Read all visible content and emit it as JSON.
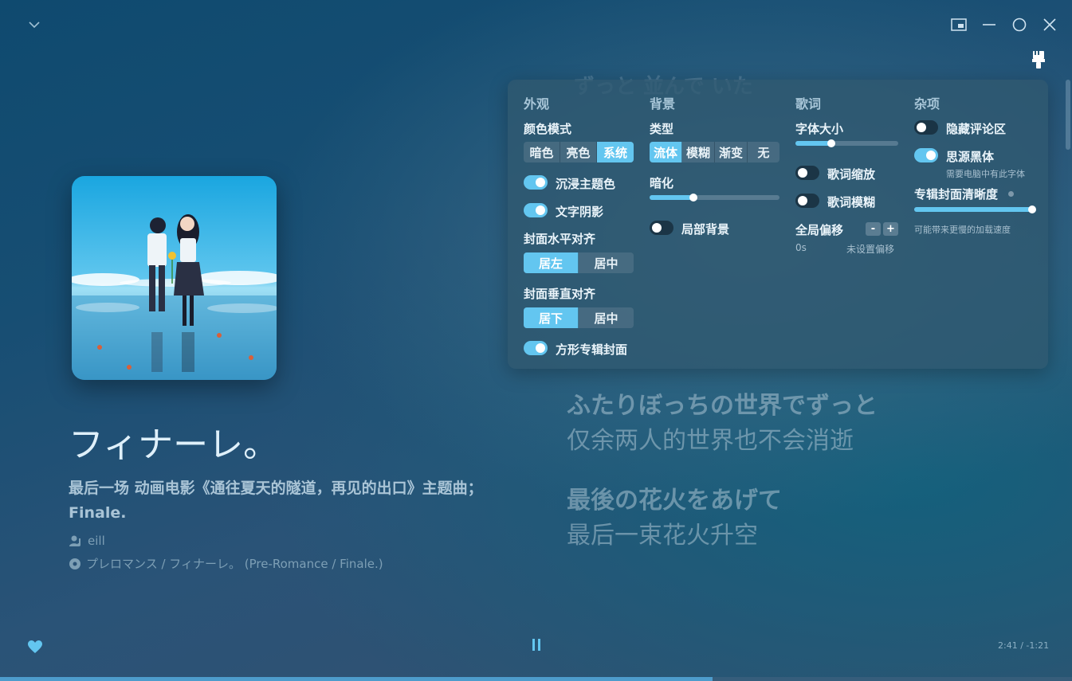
{
  "window": {
    "collapse_icon": "chevron-down-icon",
    "controls": [
      "mini-player-icon",
      "minimize-icon",
      "maximize-icon",
      "close-icon"
    ],
    "settings_icon": "brush-icon"
  },
  "song": {
    "title": "フィナーレ。",
    "subtitle": "最后一场 动画电影《通往夏天的隧道，再见的出口》主题曲；  Finale.",
    "artist": "eill",
    "album": "プレロマンス / フィナーレ。 (Pre-Romance / Finale.)"
  },
  "lyrics": {
    "faded_prev": "ずっと 並んで いた",
    "lines": [
      {
        "original": "ふたりぼっちの世界でずっと",
        "translation": "仅余两人的世界也不会消逝"
      },
      {
        "original": "最後の花火をあげて",
        "translation": "最后一束花火升空"
      }
    ]
  },
  "settings": {
    "appearance": {
      "title": "外观",
      "color_mode_label": "颜色模式",
      "color_mode_options": [
        "暗色",
        "亮色",
        "系统"
      ],
      "color_mode_selected": 2,
      "immersive_theme_label": "沉浸主题色",
      "immersive_theme_on": true,
      "text_shadow_label": "文字阴影",
      "text_shadow_on": true,
      "cover_h_align_label": "封面水平对齐",
      "cover_h_align_options": [
        "居左",
        "居中"
      ],
      "cover_h_align_selected": 0,
      "cover_v_align_label": "封面垂直对齐",
      "cover_v_align_options": [
        "居下",
        "居中"
      ],
      "cover_v_align_selected": 0,
      "square_cover_label": "方形专辑封面",
      "square_cover_on": true
    },
    "background": {
      "title": "背景",
      "type_label": "类型",
      "type_options": [
        "流体",
        "模糊",
        "渐变",
        "无"
      ],
      "type_selected": 0,
      "dim_label": "暗化",
      "dim_value": 0.34,
      "partial_bg_label": "局部背景",
      "partial_bg_on": false
    },
    "lyrics": {
      "title": "歌词",
      "font_size_label": "字体大小",
      "font_size_value": 0.35,
      "lyric_scale_label": "歌词缩放",
      "lyric_scale_on": false,
      "lyric_blur_label": "歌词模糊",
      "lyric_blur_on": false,
      "offset_label": "全局偏移",
      "offset_minus": "-",
      "offset_plus": "+",
      "offset_value": "0s",
      "offset_status": "未设置偏移"
    },
    "misc": {
      "title": "杂项",
      "hide_comments_label": "隐藏评论区",
      "hide_comments_on": false,
      "source_han_label": "思源黑体",
      "source_han_on": true,
      "source_han_hint": "需要电脑中有此字体",
      "cover_quality_label": "专辑封面清晰度",
      "cover_quality_value": 1.0,
      "cover_quality_hint": "可能带来更慢的加载速度"
    }
  },
  "player": {
    "time": "2:41 / -1:21",
    "progress": 0.665,
    "liked": true
  },
  "colors": {
    "accent": "#63c6f0",
    "panel": "#305870"
  }
}
